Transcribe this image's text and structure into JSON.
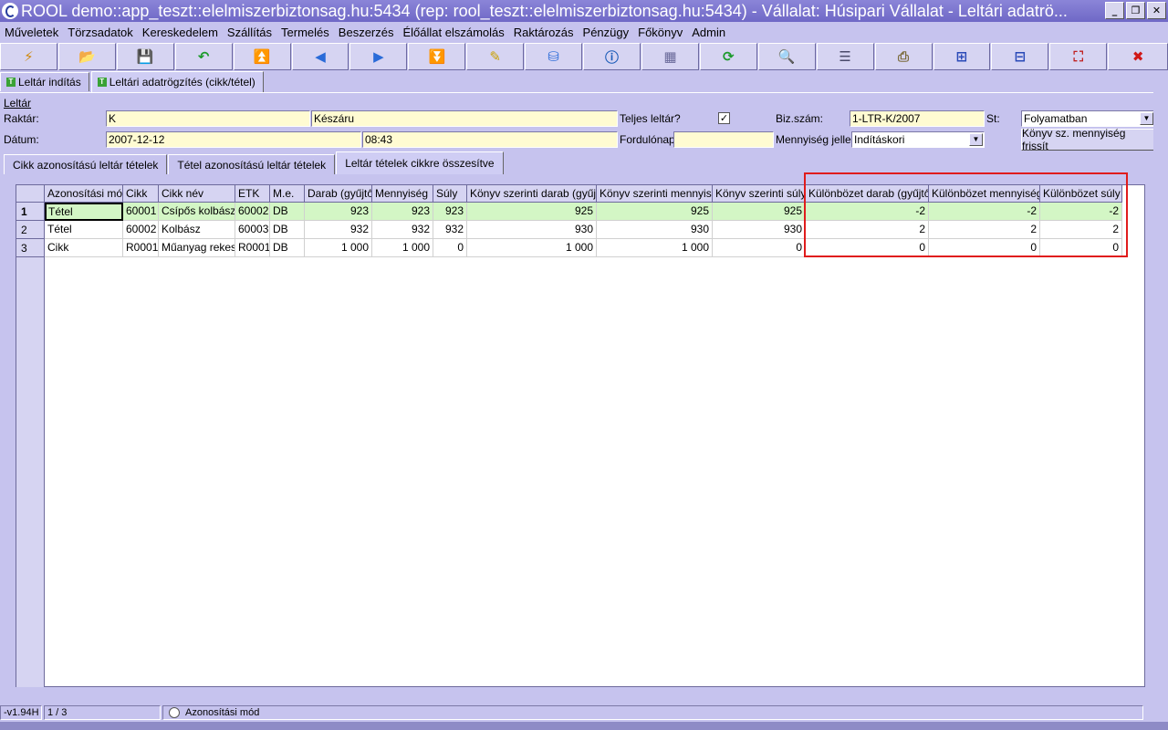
{
  "window": {
    "title": "ROOL demo::app_teszt::elelmiszerbiztonsag.hu:5434 (rep: rool_teszt::elelmiszerbiztonsag.hu:5434) - Vállalat: Húsipari Vállalat - Leltári adatrö...",
    "minimize": "_",
    "restore": "❐",
    "close": "✕"
  },
  "menu": [
    "Műveletek",
    "Törzsadatok",
    "Kereskedelem",
    "Szállítás",
    "Termelés",
    "Beszerzés",
    "Élőállat elszámolás",
    "Raktározás",
    "Pénzügy",
    "Főkönyv",
    "Admin"
  ],
  "toolbar": [
    {
      "icon": "lightning-icon",
      "glyph": "⚡",
      "color": "#d08a10"
    },
    {
      "icon": "open-folder-icon",
      "glyph": "📂",
      "color": "#2a5bb8"
    },
    {
      "icon": "save-icon",
      "glyph": "💾",
      "color": "#3a3a7a"
    },
    {
      "icon": "undo-icon",
      "glyph": "↶",
      "color": "#1c9a2c"
    },
    {
      "icon": "first-record-icon",
      "glyph": "⏫",
      "color": "#2a6bd8"
    },
    {
      "icon": "previous-record-icon",
      "glyph": "◀",
      "color": "#2a6bd8"
    },
    {
      "icon": "next-record-icon",
      "glyph": "▶",
      "color": "#2a6bd8"
    },
    {
      "icon": "last-record-icon",
      "glyph": "⏬",
      "color": "#2a6bd8"
    },
    {
      "icon": "edit-icon",
      "glyph": "✎",
      "color": "#c9a000"
    },
    {
      "icon": "database-icon",
      "glyph": "⛁",
      "color": "#2a6bd8"
    },
    {
      "icon": "info-icon",
      "glyph": "ⓘ",
      "color": "#1a5bb8"
    },
    {
      "icon": "form-view-icon",
      "glyph": "▦",
      "color": "#6a6a9a"
    },
    {
      "icon": "refresh-icon",
      "glyph": "⟳",
      "color": "#1c9a2c"
    },
    {
      "icon": "search-icon",
      "glyph": "🔍",
      "color": "#3a5a9a"
    },
    {
      "icon": "list-view-icon",
      "glyph": "☰",
      "color": "#4a4a6a"
    },
    {
      "icon": "print-icon",
      "glyph": "⎙",
      "color": "#7a6a3a"
    },
    {
      "icon": "grid-export-icon",
      "glyph": "⊞",
      "color": "#2a4ab8"
    },
    {
      "icon": "grid-import-icon",
      "glyph": "⊟",
      "color": "#2a4ab8"
    },
    {
      "icon": "fullscreen-icon",
      "glyph": "⛶",
      "color": "#c02020"
    },
    {
      "icon": "exit-icon",
      "glyph": "✖",
      "color": "#d01818"
    }
  ],
  "formtabs": [
    {
      "label": "Leltár indítás",
      "active": false
    },
    {
      "label": "Leltári adatrögzítés (cikk/tétel)",
      "active": true
    }
  ],
  "form": {
    "section": "Leltár",
    "raktar_label": "Raktár:",
    "raktar_code": "K",
    "raktar_name": "Készáru",
    "teljes_label": "Teljes leltár?",
    "teljes_checked": "✓",
    "bizszam_label": "Biz.szám:",
    "bizszam": "1-LTR-K/2007",
    "st_label": "St:",
    "st_value": "Folyamatban",
    "datum_label": "Dátum:",
    "datum": "2007-12-12",
    "ido": "08:43",
    "fordulonap_label": "Fordulónap:",
    "fordulonap": "",
    "jelleg_label": "Mennyiség jelleg:",
    "jelleg_value": "Indításkori",
    "refresh_button": "Könyv sz. mennyiség frissít"
  },
  "innertabs": [
    {
      "label": "Cikk azonosítású leltár tételek",
      "active": false
    },
    {
      "label": "Tétel azonosítású leltár tételek",
      "active": false
    },
    {
      "label": "Leltár tételek cikkre összesítve",
      "active": true
    }
  ],
  "grid": {
    "columns": [
      "Azonosítási mód",
      "Cikk",
      "Cikk név",
      "ETK",
      "M.e.",
      "Darab (gyűjtő)",
      "Mennyiség",
      "Súly",
      "Könyv szerinti darab (gyűjtő)",
      "Könyv szerinti mennyiség",
      "Könyv szerinti súly",
      "Különbözet darab (gyűjtő)",
      "Különbözet mennyiség",
      "Különbözet súly"
    ],
    "rows": [
      {
        "num": "1",
        "cells": [
          "Tétel",
          "60001",
          "Csípős kolbász",
          "60002",
          "DB",
          "923",
          "923",
          "923",
          "925",
          "925",
          "925",
          "-2",
          "-2",
          "-2"
        ]
      },
      {
        "num": "2",
        "cells": [
          "Tétel",
          "60002",
          "Kolbász",
          "60003",
          "DB",
          "932",
          "932",
          "932",
          "930",
          "930",
          "930",
          "2",
          "2",
          "2"
        ]
      },
      {
        "num": "3",
        "cells": [
          "Cikk",
          "R0001",
          "Műanyag rekesz",
          "R0001",
          "DB",
          "1 000",
          "1 000",
          "0",
          "1 000",
          "1 000",
          "0",
          "0",
          "0",
          "0"
        ]
      }
    ]
  },
  "status": {
    "version": "-v1.94H",
    "position": "1 / 3",
    "mode": "Azonosítási mód"
  }
}
